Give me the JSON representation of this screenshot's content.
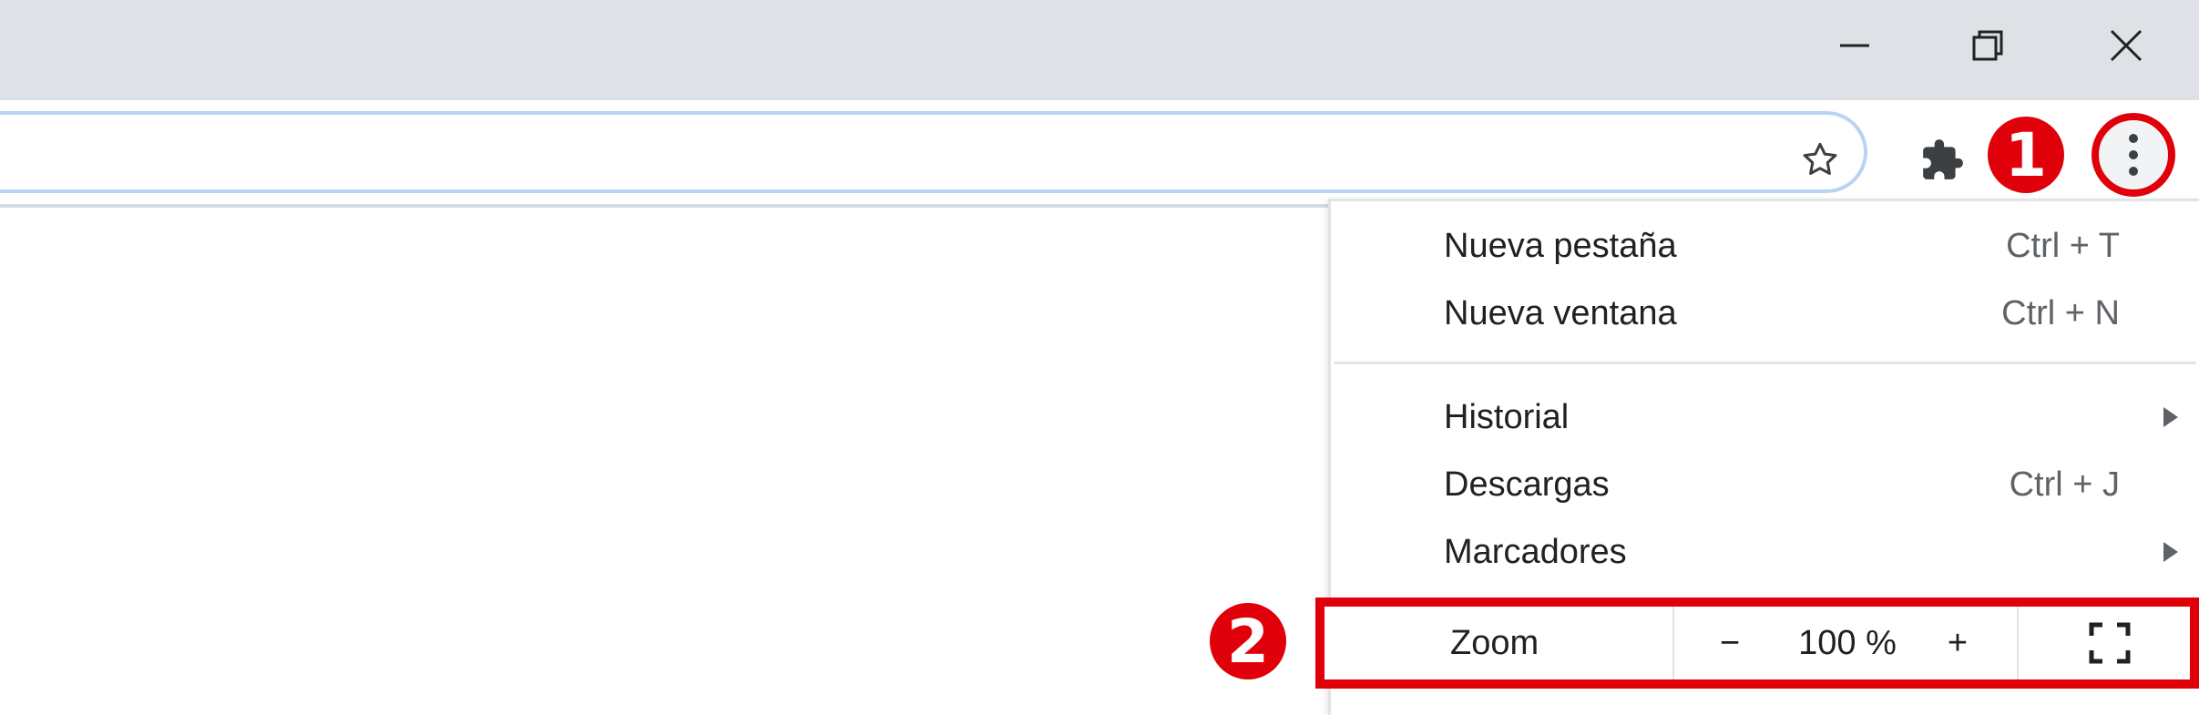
{
  "window": {
    "controls": {
      "minimize_icon": "minimize-icon",
      "restore_icon": "restore-icon",
      "close_icon": "close-icon"
    }
  },
  "toolbar": {
    "bookmark_icon": "star-icon",
    "extensions_icon": "puzzle-icon",
    "menu_icon": "three-dots-vertical-icon"
  },
  "markers": {
    "step1": "1",
    "step2": "2",
    "color": "#e0000a"
  },
  "menu": {
    "items": [
      {
        "label": "Nueva pestaña",
        "shortcut": "Ctrl + T"
      },
      {
        "label": "Nueva ventana",
        "shortcut": "Ctrl + N"
      },
      {
        "label": "Historial",
        "submenu": true
      },
      {
        "label": "Descargas",
        "shortcut": "Ctrl + J"
      },
      {
        "label": "Marcadores",
        "submenu": true
      }
    ],
    "zoom": {
      "label": "Zoom",
      "minus": "−",
      "value": "100 %",
      "plus": "+",
      "fullscreen_icon": "fullscreen-icon"
    }
  },
  "colors": {
    "titlebar": "#dee1e6",
    "omnibox_border": "#b9d3f5",
    "highlight": "#e0000a"
  }
}
